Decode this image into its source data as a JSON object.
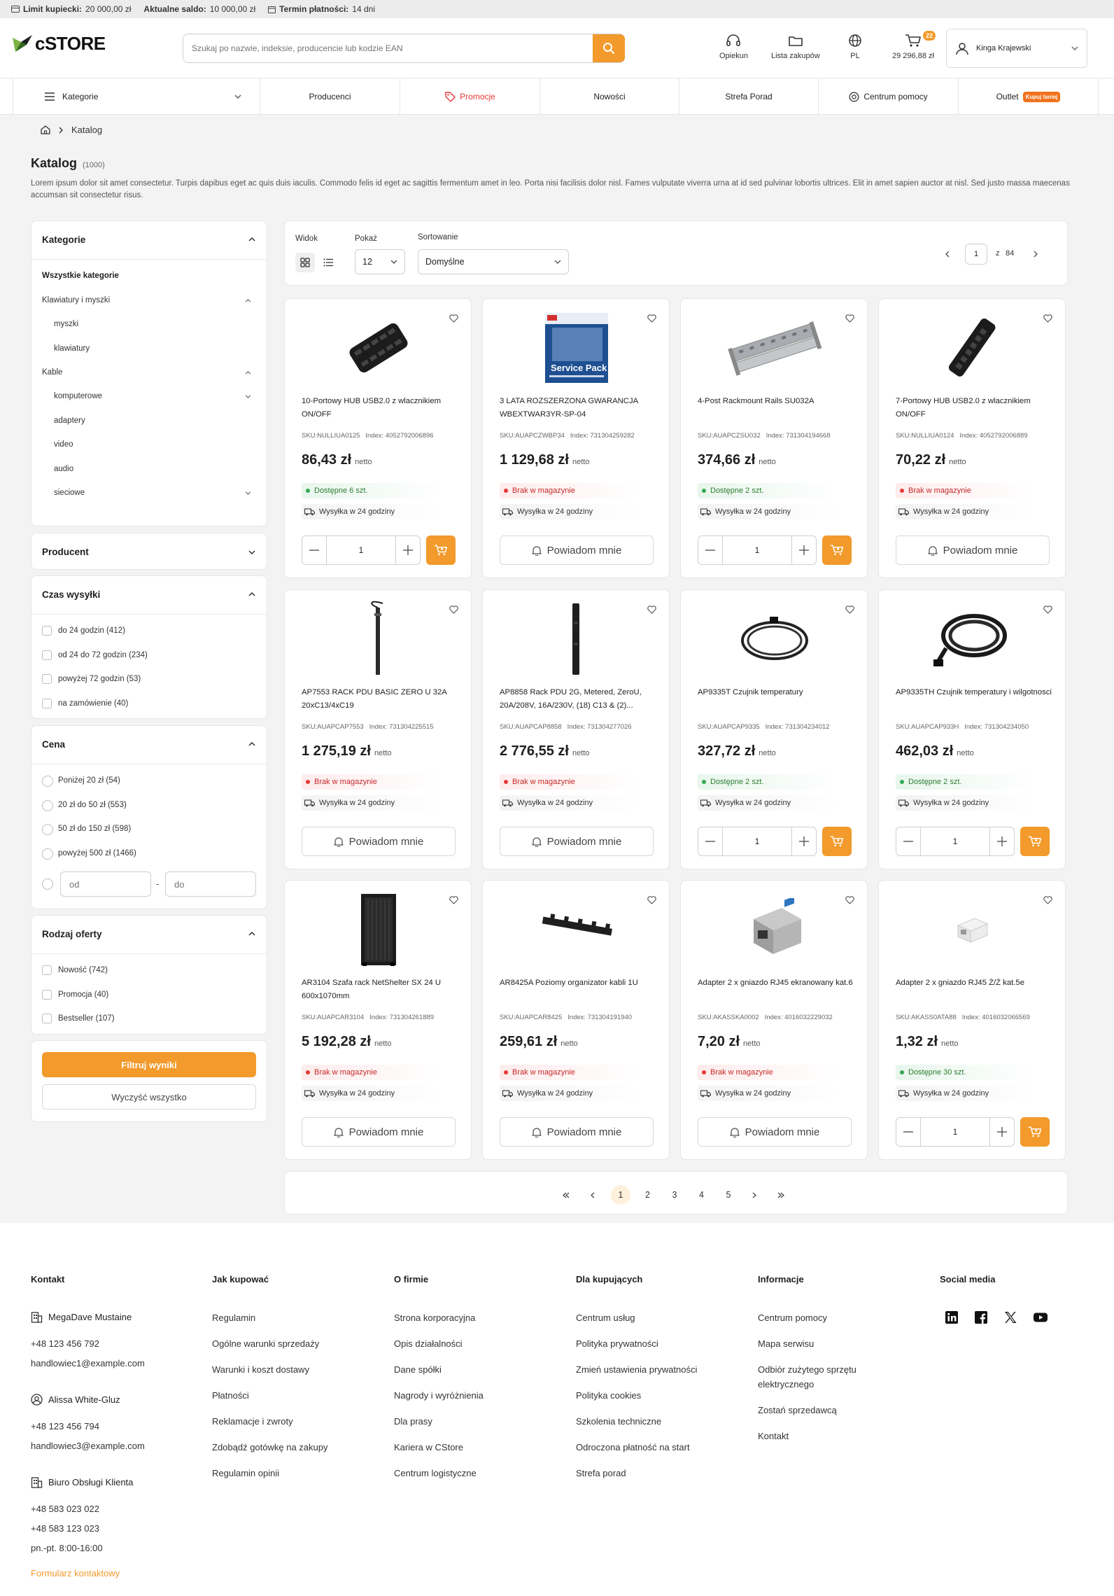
{
  "topbar": {
    "limit_label": "Limit kupiecki:",
    "limit_value": "20 000,00 zł",
    "balance_label": "Aktualne saldo:",
    "balance_value": "10 000,00 zł",
    "term_label": "Termin płatności:",
    "term_value": "14 dni"
  },
  "header": {
    "logo": "cSTORE",
    "search_placeholder": "Szukaj po nazwie, indeksie, producencie lub kodzie EAN",
    "icons": {
      "support": "Opiekun",
      "lists": "Lista zakupów",
      "lang": "PL",
      "cart_total": "29 296,88 zł",
      "cart_count": "22"
    },
    "user": "Kinga Krajewski"
  },
  "nav": {
    "categories": "Kategorie",
    "producers": "Producenci",
    "promo": "Promocje",
    "news": "Nowości",
    "advice": "Strefa Porad",
    "help": "Centrum pomocy",
    "outlet": "Outlet",
    "outlet_badge": "Kupuj taniej"
  },
  "breadcrumb": {
    "current": "Katalog"
  },
  "page": {
    "title": "Katalog",
    "count": "(1000)",
    "description": "Lorem ipsum dolor sit amet consectetur. Turpis dapibus eget ac quis duis iaculis. Commodo felis id eget ac sagittis fermentum amet in leo. Porta nisi facilisis dolor nisl. Fames vulputate viverra urna at id sed pulvinar lobortis ultrices. Elit in amet sapien auctor at nisl. Sed justo massa maecenas accumsan sit consectetur risus."
  },
  "sidebar": {
    "categories_title": "Kategorie",
    "all": "Wszystkie kategorie",
    "tree": {
      "kb": "Klawiatury i myszki",
      "mice": "myszki",
      "keyboards": "klawiatury",
      "cables": "Kable",
      "computer": "komputerowe",
      "adapters": "adaptery",
      "video": "video",
      "audio": "audio",
      "network": "sieciowe"
    },
    "producer_title": "Producent",
    "shipping_title": "Czas wysyłki",
    "shipping": [
      "do 24 godzin (412)",
      "od 24 do 72 godzin (234)",
      "powyżej 72 godzin (53)",
      "na zamówienie (40)"
    ],
    "price_title": "Cena",
    "prices": [
      "Poniżej 20 zł (54)",
      "20 zł do 50 zł (553)",
      "50 zł do 150 zł (598)",
      "powyżej 500 zł (1466)"
    ],
    "price_from": "od",
    "price_to": "do",
    "price_sep": "-",
    "offer_title": "Rodzaj oferty",
    "offers": [
      "Nowość (742)",
      "Promocja (40)",
      "Bestseller (107)"
    ],
    "filter_btn": "Filtruj wyniki",
    "clear_btn": "Wyczyść wszystko"
  },
  "toolbar": {
    "view_label": "Widok",
    "show_label": "Pokaż",
    "show_value": "12",
    "sort_label": "Sortowanie",
    "sort_value": "Domyślne",
    "page": "1",
    "of": "z",
    "total_pages": "84"
  },
  "products": [
    {
      "name": "10-Portowy HUB USB2.0 z wlacznikiem ON/OFF",
      "sku": "SKU:NULLIUA0125",
      "index": "Index: 4052792006896",
      "price": "86,43 zł",
      "unit": "netto",
      "stock": "Dostępne 6 szt.",
      "ok": true,
      "ship": "Wysyłka w 24 godziny",
      "qty": "1",
      "notify": "Powiadom mnie",
      "img": "hub"
    },
    {
      "name": "3 LATA ROZSZERZONA GWARANCJA WBEXTWAR3YR-SP-04",
      "sku": "SKU:AUAPCZWBP34",
      "index": "Index: 731304259282",
      "price": "1 129,68 zł",
      "unit": "netto",
      "stock": "Brak w magazynie",
      "ok": false,
      "ship": "Wysyłka w 24 godziny",
      "qty": "1",
      "notify": "Powiadom mnie",
      "img": "box",
      "box_text": "Service Pack"
    },
    {
      "name": "4-Post Rackmount Rails SU032A",
      "sku": "SKU:AUAPCZSU032",
      "index": "Index: 731304194668",
      "price": "374,66 zł",
      "unit": "netto",
      "stock": "Dostępne 2 szt.",
      "ok": true,
      "ship": "Wysyłka w 24 godziny",
      "qty": "1",
      "notify": "Powiadom mnie",
      "img": "rails"
    },
    {
      "name": "7-Portowy HUB USB2.0 z wlacznikiem ON/OFF",
      "sku": "SKU:NULLIUA0124",
      "index": "Index: 4052792006889",
      "price": "70,22 zł",
      "unit": "netto",
      "stock": "Brak w magazynie",
      "ok": false,
      "ship": "Wysyłka w 24 godziny",
      "qty": "1",
      "notify": "Powiadom mnie",
      "img": "hub7"
    },
    {
      "name": "AP7553 RACK PDU BASIC ZERO U 32A 20xC13/4xC19",
      "sku": "SKU:AUAPCAP7553",
      "index": "Index: 731304225515",
      "price": "1 275,19 zł",
      "unit": "netto",
      "stock": "Brak w magazynie",
      "ok": false,
      "ship": "Wysyłka w 24 godziny",
      "qty": "1",
      "notify": "Powiadom mnie",
      "img": "pdu"
    },
    {
      "name": "AP8858 Rack PDU 2G, Metered, ZeroU, 20A/208V, 16A/230V, (18) C13 & (2)...",
      "sku": "SKU:AUAPCAP8858",
      "index": "Index: 731304277026",
      "price": "2 776,55 zł",
      "unit": "netto",
      "stock": "Brak w magazynie",
      "ok": false,
      "ship": "Wysyłka w 24 godziny",
      "qty": "1",
      "notify": "Powiadom mnie",
      "img": "pdu2"
    },
    {
      "name": "AP9335T Czujnik temperatury",
      "sku": "SKU:AUAPCAP9335",
      "index": "Index: 731304234012",
      "price": "327,72 zł",
      "unit": "netto",
      "stock": "Dostępne 2 szt.",
      "ok": true,
      "ship": "Wysyłka w 24 godziny",
      "qty": "1",
      "notify": "Powiadom mnie",
      "img": "cable"
    },
    {
      "name": "AP9335TH Czujnik temperatury i wilgotnosci",
      "sku": "SKU:AUAPCAP933H",
      "index": "Index: 731304234050",
      "price": "462,03 zł",
      "unit": "netto",
      "stock": "Dostępne 2 szt.",
      "ok": true,
      "ship": "Wysyłka w 24 godziny",
      "qty": "1",
      "notify": "Powiadom mnie",
      "img": "cable2"
    },
    {
      "name": "AR3104 Szafa rack NetShelter SX 24 U 600x1070mm",
      "sku": "SKU:AUAPCAR3104",
      "index": "Index: 731304261889",
      "price": "5 192,28 zł",
      "unit": "netto",
      "stock": "Brak w magazynie",
      "ok": false,
      "ship": "Wysyłka w 24 godziny",
      "qty": "1",
      "notify": "Powiadom mnie",
      "img": "rack"
    },
    {
      "name": "AR8425A Poziomy organizator kabli 1U",
      "sku": "SKU:AUAPCAR8425",
      "index": "Index: 731304191940",
      "price": "259,61 zł",
      "unit": "netto",
      "stock": "Brak w magazynie",
      "ok": false,
      "ship": "Wysyłka w 24 godziny",
      "qty": "1",
      "notify": "Powiadom mnie",
      "img": "organizer"
    },
    {
      "name": "Adapter 2 x gniazdo RJ45 ekranowany kat.6",
      "sku": "SKU:AKASSKA0002",
      "index": "Index: 4016032229032",
      "price": "7,20 zł",
      "unit": "netto",
      "stock": "Brak w magazynie",
      "ok": false,
      "ship": "Wysyłka w 24 godziny",
      "qty": "1",
      "notify": "Powiadom mnie",
      "img": "rj45"
    },
    {
      "name": "Adapter 2 x gniazdo RJ45 Ż/Ż kat.5e",
      "sku": "SKU:AKASS0ATA88",
      "index": "Index: 4016032066569",
      "price": "1,32 zł",
      "unit": "netto",
      "stock": "Dostępne 30 szt.",
      "ok": true,
      "ship": "Wysyłka w 24 godziny",
      "qty": "1",
      "notify": "Powiadom mnie",
      "img": "coupler"
    }
  ],
  "pagination": [
    "1",
    "2",
    "3",
    "4",
    "5"
  ],
  "footer": {
    "contact_title": "Kontakt",
    "person1": "MegaDave Mustaine",
    "phone1": "+48 123 456 792",
    "email1": "handlowiec1@example.com",
    "person2": "Alissa White-Gluz",
    "phone2": "+48 123 456 794",
    "email2": "handlowiec3@example.com",
    "office": "Biuro Obsługi Klienta",
    "phone3": "+48 583 023 022",
    "phone4": "+48 583 123 023",
    "hours": "pn.-pt. 8:00-16:00",
    "form_link": "Formularz kontaktowy",
    "how_title": "Jak kupować",
    "how": [
      "Regulamin",
      "Ogólne warunki sprzedaży",
      "Warunki i koszt dostawy",
      "Płatności",
      "Reklamacje i zwroty",
      "Zdobądź gotówkę na zakupy",
      "Regulamin opinii"
    ],
    "about_title": "O firmie",
    "about": [
      "Strona korporacyjna",
      "Opis działalności",
      "Dane spółki",
      "Nagrody i wyróżnienia",
      "Dla prasy",
      "Kariera w CStore",
      "Centrum logistyczne"
    ],
    "buyers_title": "Dla kupujących",
    "buyers": [
      "Centrum usług",
      "Polityka prywatności",
      "Zmień ustawienia prywatności",
      "Polityka cookies",
      "Szkolenia techniczne",
      "Odroczona płatność na start",
      "Strefa porad"
    ],
    "info_title": "Informacje",
    "info": [
      "Centrum pomocy",
      "Mapa serwisu",
      "Odbiór zużytego sprzętu elektrycznego",
      "Zostań sprzedawcą",
      "Kontakt"
    ],
    "social_title": "Social media"
  },
  "colors": {
    "accent": "#f29a2b",
    "danger": "#e53935",
    "success": "#34a853"
  }
}
